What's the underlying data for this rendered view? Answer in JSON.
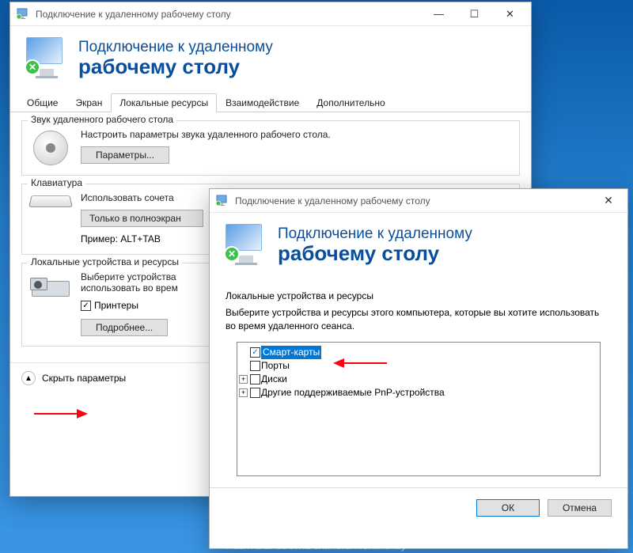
{
  "main": {
    "title": "Подключение к удаленному рабочему столу",
    "banner": {
      "line1": "Подключение к удаленному",
      "line2": "рабочему столу",
      "badge": "✕"
    },
    "tabs": [
      "Общие",
      "Экран",
      "Локальные ресурсы",
      "Взаимодействие",
      "Дополнительно"
    ],
    "active_tab_index": 2,
    "sound": {
      "legend": "Звук удаленного рабочего стола",
      "desc": "Настроить параметры звука удаленного рабочего стола.",
      "btn": "Параметры..."
    },
    "keyboard": {
      "legend": "Клавиатура",
      "desc": "Использовать сочета",
      "dropdown": "Только в полноэкран",
      "example": "Пример: ALT+TAB"
    },
    "devices": {
      "legend": "Локальные устройства и ресурсы",
      "desc": "Выберите устройства\nиспользовать во врем",
      "printers": "Принтеры",
      "more": "Подробнее..."
    },
    "footer": {
      "hide": "Скрыть параметры"
    }
  },
  "sub": {
    "title": "Подключение к удаленному рабочему столу",
    "banner": {
      "line1": "Подключение к удаленному",
      "line2": "рабочему столу",
      "badge": "✕"
    },
    "group_legend": "Локальные устройства и ресурсы",
    "desc": "Выберите устройства и ресурсы этого компьютера, которые вы хотите использовать во время удаленного сеанса.",
    "tree": [
      {
        "label": "Смарт-карты",
        "checked": true,
        "selected": true,
        "expandable": false
      },
      {
        "label": "Порты",
        "checked": false,
        "selected": false,
        "expandable": false
      },
      {
        "label": "Диски",
        "checked": false,
        "selected": false,
        "expandable": true
      },
      {
        "label": "Другие поддерживаемые PnP-устройства",
        "checked": false,
        "selected": false,
        "expandable": true
      }
    ],
    "ok": "ОК",
    "cancel": "Отмена"
  },
  "watermark": "PachvaraPetrovna для forum.onliner.by"
}
